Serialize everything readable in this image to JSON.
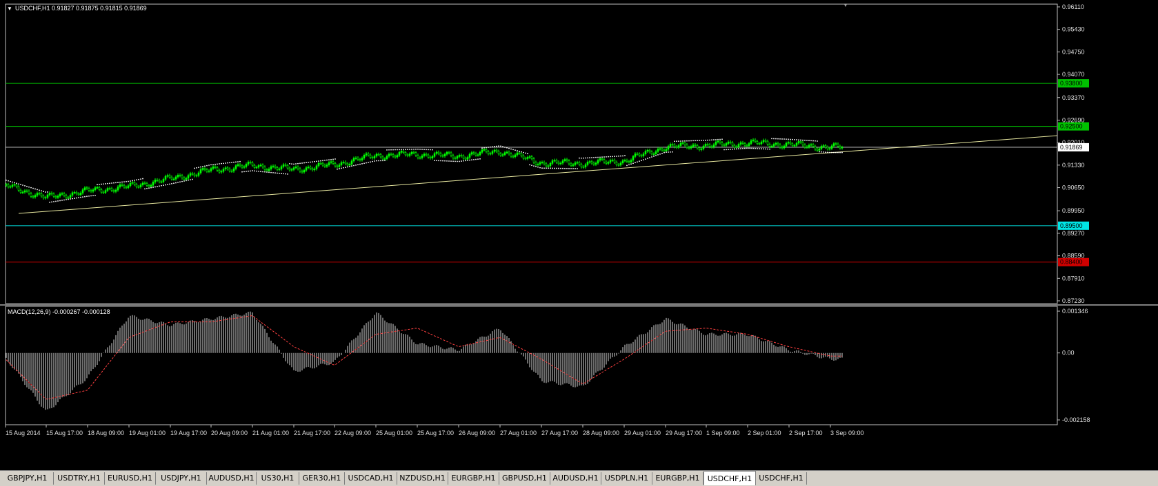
{
  "price_panel": {
    "header": "USDCHF,H1  0.91827 0.91875 0.91815 0.91869",
    "y_ticks": [
      "0.96110",
      "0.95430",
      "0.94750",
      "0.94070",
      "0.93370",
      "0.92690",
      "0.92010",
      "0.91330",
      "0.90650",
      "0.89950",
      "0.89270",
      "0.88590",
      "0.87910",
      "0.87230"
    ],
    "ylim": [
      0.8723,
      0.9611
    ],
    "hlines": [
      {
        "value": 0.938,
        "label": "0.93800",
        "color": "#00c000"
      },
      {
        "value": 0.925,
        "label": "0.92500",
        "color": "#00c000"
      },
      {
        "value": 0.91869,
        "label": "0.91869",
        "color": "#c8c8c8"
      },
      {
        "value": 0.895,
        "label": "0.89500",
        "color": "#00e5e5"
      },
      {
        "value": 0.884,
        "label": "0.88400",
        "color": "#d00000"
      }
    ],
    "trendline": {
      "start_value": 0.8987,
      "end_value": 0.9222,
      "color": "#e8e8a0"
    },
    "colors": {
      "bull": "#00ff00",
      "bear": "#ffffff",
      "dots": "#ffffff"
    }
  },
  "macd_panel": {
    "header": "MACD(12,26,9) -0.000267 -0.000128",
    "y_ticks": [
      "0.001346",
      "0.00",
      "-0.002158"
    ],
    "ylim": [
      -0.002158,
      0.001346
    ],
    "colors": {
      "hist": "#d8d8d8",
      "signal": "#ff4040"
    }
  },
  "time_axis": [
    "15 Aug 2014",
    "15 Aug 17:00",
    "18 Aug 09:00",
    "19 Aug 01:00",
    "19 Aug 17:00",
    "20 Aug 09:00",
    "21 Aug 01:00",
    "21 Aug 17:00",
    "22 Aug 09:00",
    "25 Aug 01:00",
    "25 Aug 17:00",
    "26 Aug 09:00",
    "27 Aug 01:00",
    "27 Aug 17:00",
    "28 Aug 09:00",
    "29 Aug 01:00",
    "29 Aug 17:00",
    "1 Sep 09:00",
    "2 Sep 01:00",
    "2 Sep 17:00",
    "3 Sep 09:00"
  ],
  "tabs": [
    "GBPJPY,H1",
    "USDTRY,H1",
    "EURUSD,H1",
    "USDJPY,H1",
    "AUDUSD,H1",
    "US30,H1",
    "GER30,H1",
    "USDCAD,H1",
    "NZDUSD,H1",
    "EURGBP,H1",
    "GBPUSD,H1",
    "AUDUSD,H1",
    "USDPLN,H1",
    "EURGBP,H1",
    "USDCHF,H1",
    "USDCHF,H1"
  ],
  "active_tab_index": 14,
  "chart_data": [
    {
      "type": "line",
      "title": "USDCHF,H1",
      "x": [
        "15 Aug 2014",
        "15 Aug 17:00",
        "18 Aug 09:00",
        "19 Aug 01:00",
        "19 Aug 17:00",
        "20 Aug 09:00",
        "21 Aug 01:00",
        "21 Aug 17:00",
        "22 Aug 09:00",
        "25 Aug 01:00",
        "25 Aug 17:00",
        "26 Aug 09:00",
        "27 Aug 01:00",
        "27 Aug 17:00",
        "28 Aug 09:00",
        "29 Aug 01:00",
        "29 Aug 17:00",
        "1 Sep 09:00",
        "2 Sep 01:00",
        "2 Sep 17:00",
        "3 Sep 09:00"
      ],
      "series": [
        {
          "values": [
            0.9072,
            0.9035,
            0.9055,
            0.9068,
            0.9092,
            0.9118,
            0.9132,
            0.912,
            0.9135,
            0.9162,
            0.9165,
            0.916,
            0.9175,
            0.914,
            0.9138,
            0.9145,
            0.9188,
            0.9192,
            0.92,
            0.9195,
            0.9187
          ]
        }
      ],
      "ylim": [
        0.8723,
        0.9611
      ]
    },
    {
      "type": "bar",
      "title": "MACD(12,26,9) -0.000267 -0.000128",
      "x": [
        "15 Aug 2014",
        "15 Aug 17:00",
        "18 Aug 09:00",
        "19 Aug 01:00",
        "19 Aug 17:00",
        "20 Aug 09:00",
        "21 Aug 01:00",
        "21 Aug 17:00",
        "22 Aug 09:00",
        "25 Aug 01:00",
        "25 Aug 17:00",
        "26 Aug 09:00",
        "27 Aug 01:00",
        "27 Aug 17:00",
        "28 Aug 09:00",
        "29 Aug 01:00",
        "29 Aug 17:00",
        "1 Sep 09:00",
        "2 Sep 01:00",
        "2 Sep 17:00",
        "3 Sep 09:00"
      ],
      "series": [
        {
          "values": [
            -0.00015,
            -0.0019,
            -0.0008,
            0.0012,
            0.0009,
            0.0011,
            0.0013,
            -0.0006,
            -0.0003,
            0.0013,
            0.0003,
            0.0001,
            0.0008,
            -0.0009,
            -0.0011,
            0.0002,
            0.0011,
            0.0006,
            0.0006,
            0.0001,
            -0.0002
          ]
        },
        {
          "values": [
            -0.0002,
            -0.0015,
            -0.0012,
            0.0005,
            0.001,
            0.001,
            0.0012,
            0.0002,
            -0.0004,
            0.0006,
            0.0008,
            0.0002,
            0.0005,
            -0.0002,
            -0.001,
            -0.0002,
            0.0007,
            0.0008,
            0.0006,
            0.0002,
            -0.0001
          ]
        }
      ],
      "ylim": [
        -0.002158,
        0.001346
      ]
    }
  ]
}
